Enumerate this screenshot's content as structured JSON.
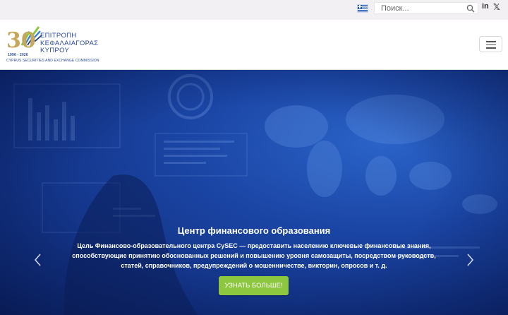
{
  "topbar": {
    "language_flag": "greek-flag-icon",
    "search_placeholder": "Поиск...",
    "search_icon": "search-icon",
    "social": {
      "linkedin": "in",
      "x": "𝕏"
    }
  },
  "header": {
    "logo": {
      "number": "30",
      "years": "1996 - 2026",
      "title_lines": [
        "ΕΠΙΤΡΟΠΗ",
        "ΚΕΦΑΛΑΙΑΓΟΡΑΣ",
        "ΚΥΠΡΟΥ"
      ],
      "subtitle": "CYPRUS SECURITIES AND EXCHANGE COMMISSION"
    },
    "menu_icon": "hamburger-menu-icon"
  },
  "hero": {
    "title": "Центр финансового образования",
    "text": "Цель Финансово-образовательного центра CySEC — предоставить населению ключевые финансовые знания, способствующие принятию обоснованных решений и повышению уровня самозащиты, посредством руководств, статей, справочников, предупреждений о мошенничестве, викторин, опросов и т. д.",
    "button_label": "УЗНАТЬ БОЛЬШЕ!",
    "prev_icon": "chevron-left-icon",
    "next_icon": "chevron-right-icon"
  },
  "colors": {
    "hero_blue": "#1b46a6",
    "button_green": "#8dc63f",
    "brand_blue": "#2a4a9a",
    "logo_gold": "#c5a85a"
  }
}
